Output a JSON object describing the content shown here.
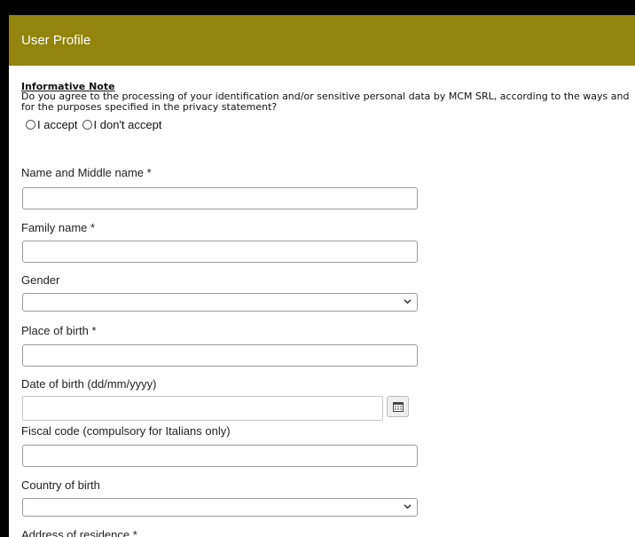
{
  "header": {
    "title": "User Profile"
  },
  "note": {
    "title": "Informative Note",
    "text": "Do you agree to the processing of your identification and/or sensitive personal data by MCM SRL, according to the ways and for the purposes specified in the privacy statement?",
    "accept_label": "I accept",
    "decline_label": "I don't accept"
  },
  "fields": {
    "first_name": {
      "label": "Name and Middle name *",
      "value": ""
    },
    "family_name": {
      "label": "Family name *",
      "value": ""
    },
    "gender": {
      "label": "Gender",
      "selected": ""
    },
    "place_of_birth": {
      "label": "Place of birth *",
      "value": ""
    },
    "date_of_birth": {
      "label": "Date of birth (dd/mm/yyyy)",
      "value": ""
    },
    "fiscal_code": {
      "label": "Fiscal code (compulsory for Italians only)",
      "value": ""
    },
    "country_of_birth": {
      "label": "Country of birth",
      "selected": ""
    },
    "address": {
      "label": "Address of residence *"
    }
  },
  "icons": {
    "calendar": "calendar-icon",
    "select_arrow": "chevron-down-icon"
  },
  "colors": {
    "header_bg": "#93840d",
    "page_bg": "#000000",
    "panel_bg": "#ffffff"
  }
}
